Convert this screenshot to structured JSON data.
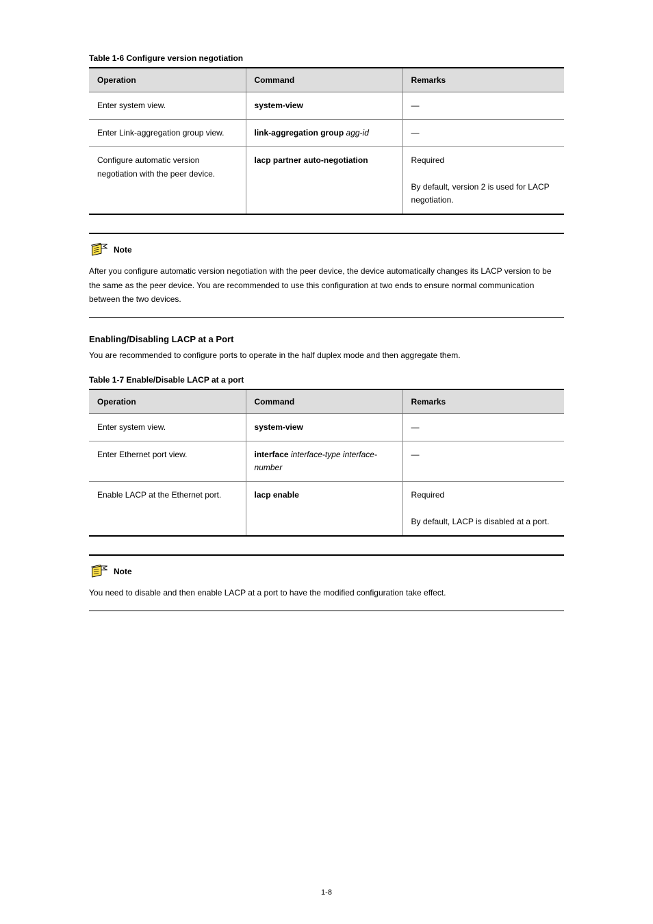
{
  "table1": {
    "title": "Table 1-6 Configure version negotiation",
    "headers": [
      "Operation",
      "Command",
      "Remarks"
    ],
    "rows": [
      [
        {
          "text": "Enter system view."
        },
        {
          "text": "system-view",
          "bold": true
        },
        {
          "text": "—"
        }
      ],
      [
        {
          "text": "Enter Link-aggregation group view."
        },
        {
          "pre": "link-aggregation group ",
          "bold": true,
          "post_italic": "agg-id"
        },
        {
          "text": "—"
        }
      ],
      [
        {
          "text": "Configure automatic version negotiation with the peer device."
        },
        {
          "text": "lacp partner auto-negotiation",
          "bold": true
        },
        {
          "text": "Required\n\nBy default, version 2 is used for LACP negotiation."
        }
      ]
    ]
  },
  "note1": {
    "label": "Note",
    "text": "After you configure automatic version negotiation with the peer device, the device automatically changes its LACP version to be the same as the peer device. You are recommended to use this configuration at two ends to ensure normal communication between the two devices."
  },
  "section": {
    "heading": "Enabling/Disabling LACP at a Port",
    "para": "You are recommended to configure ports to operate in the half duplex mode and then aggregate them."
  },
  "table2": {
    "title": "Table 1-7 Enable/Disable LACP at a port",
    "headers": [
      "Operation",
      "Command",
      "Remarks"
    ],
    "rows": [
      [
        {
          "text": "Enter system view."
        },
        {
          "text": "system-view",
          "bold": true
        },
        {
          "text": "—"
        }
      ],
      [
        {
          "text": "Enter Ethernet port view."
        },
        {
          "parts": [
            {
              "text": "interface ",
              "bold": true
            },
            {
              "text": "interface-type interface-number",
              "italic": true
            }
          ]
        },
        {
          "text": "—"
        }
      ],
      [
        {
          "text": "Enable LACP at the Ethernet port."
        },
        {
          "text": "lacp enable",
          "bold": true
        },
        {
          "text": "Required\n\nBy default, LACP is disabled at a port."
        }
      ]
    ]
  },
  "note2": {
    "label": "Note",
    "text": "You need to disable and then enable LACP at a port to have the modified configuration take effect."
  },
  "pagenum": "1-8"
}
